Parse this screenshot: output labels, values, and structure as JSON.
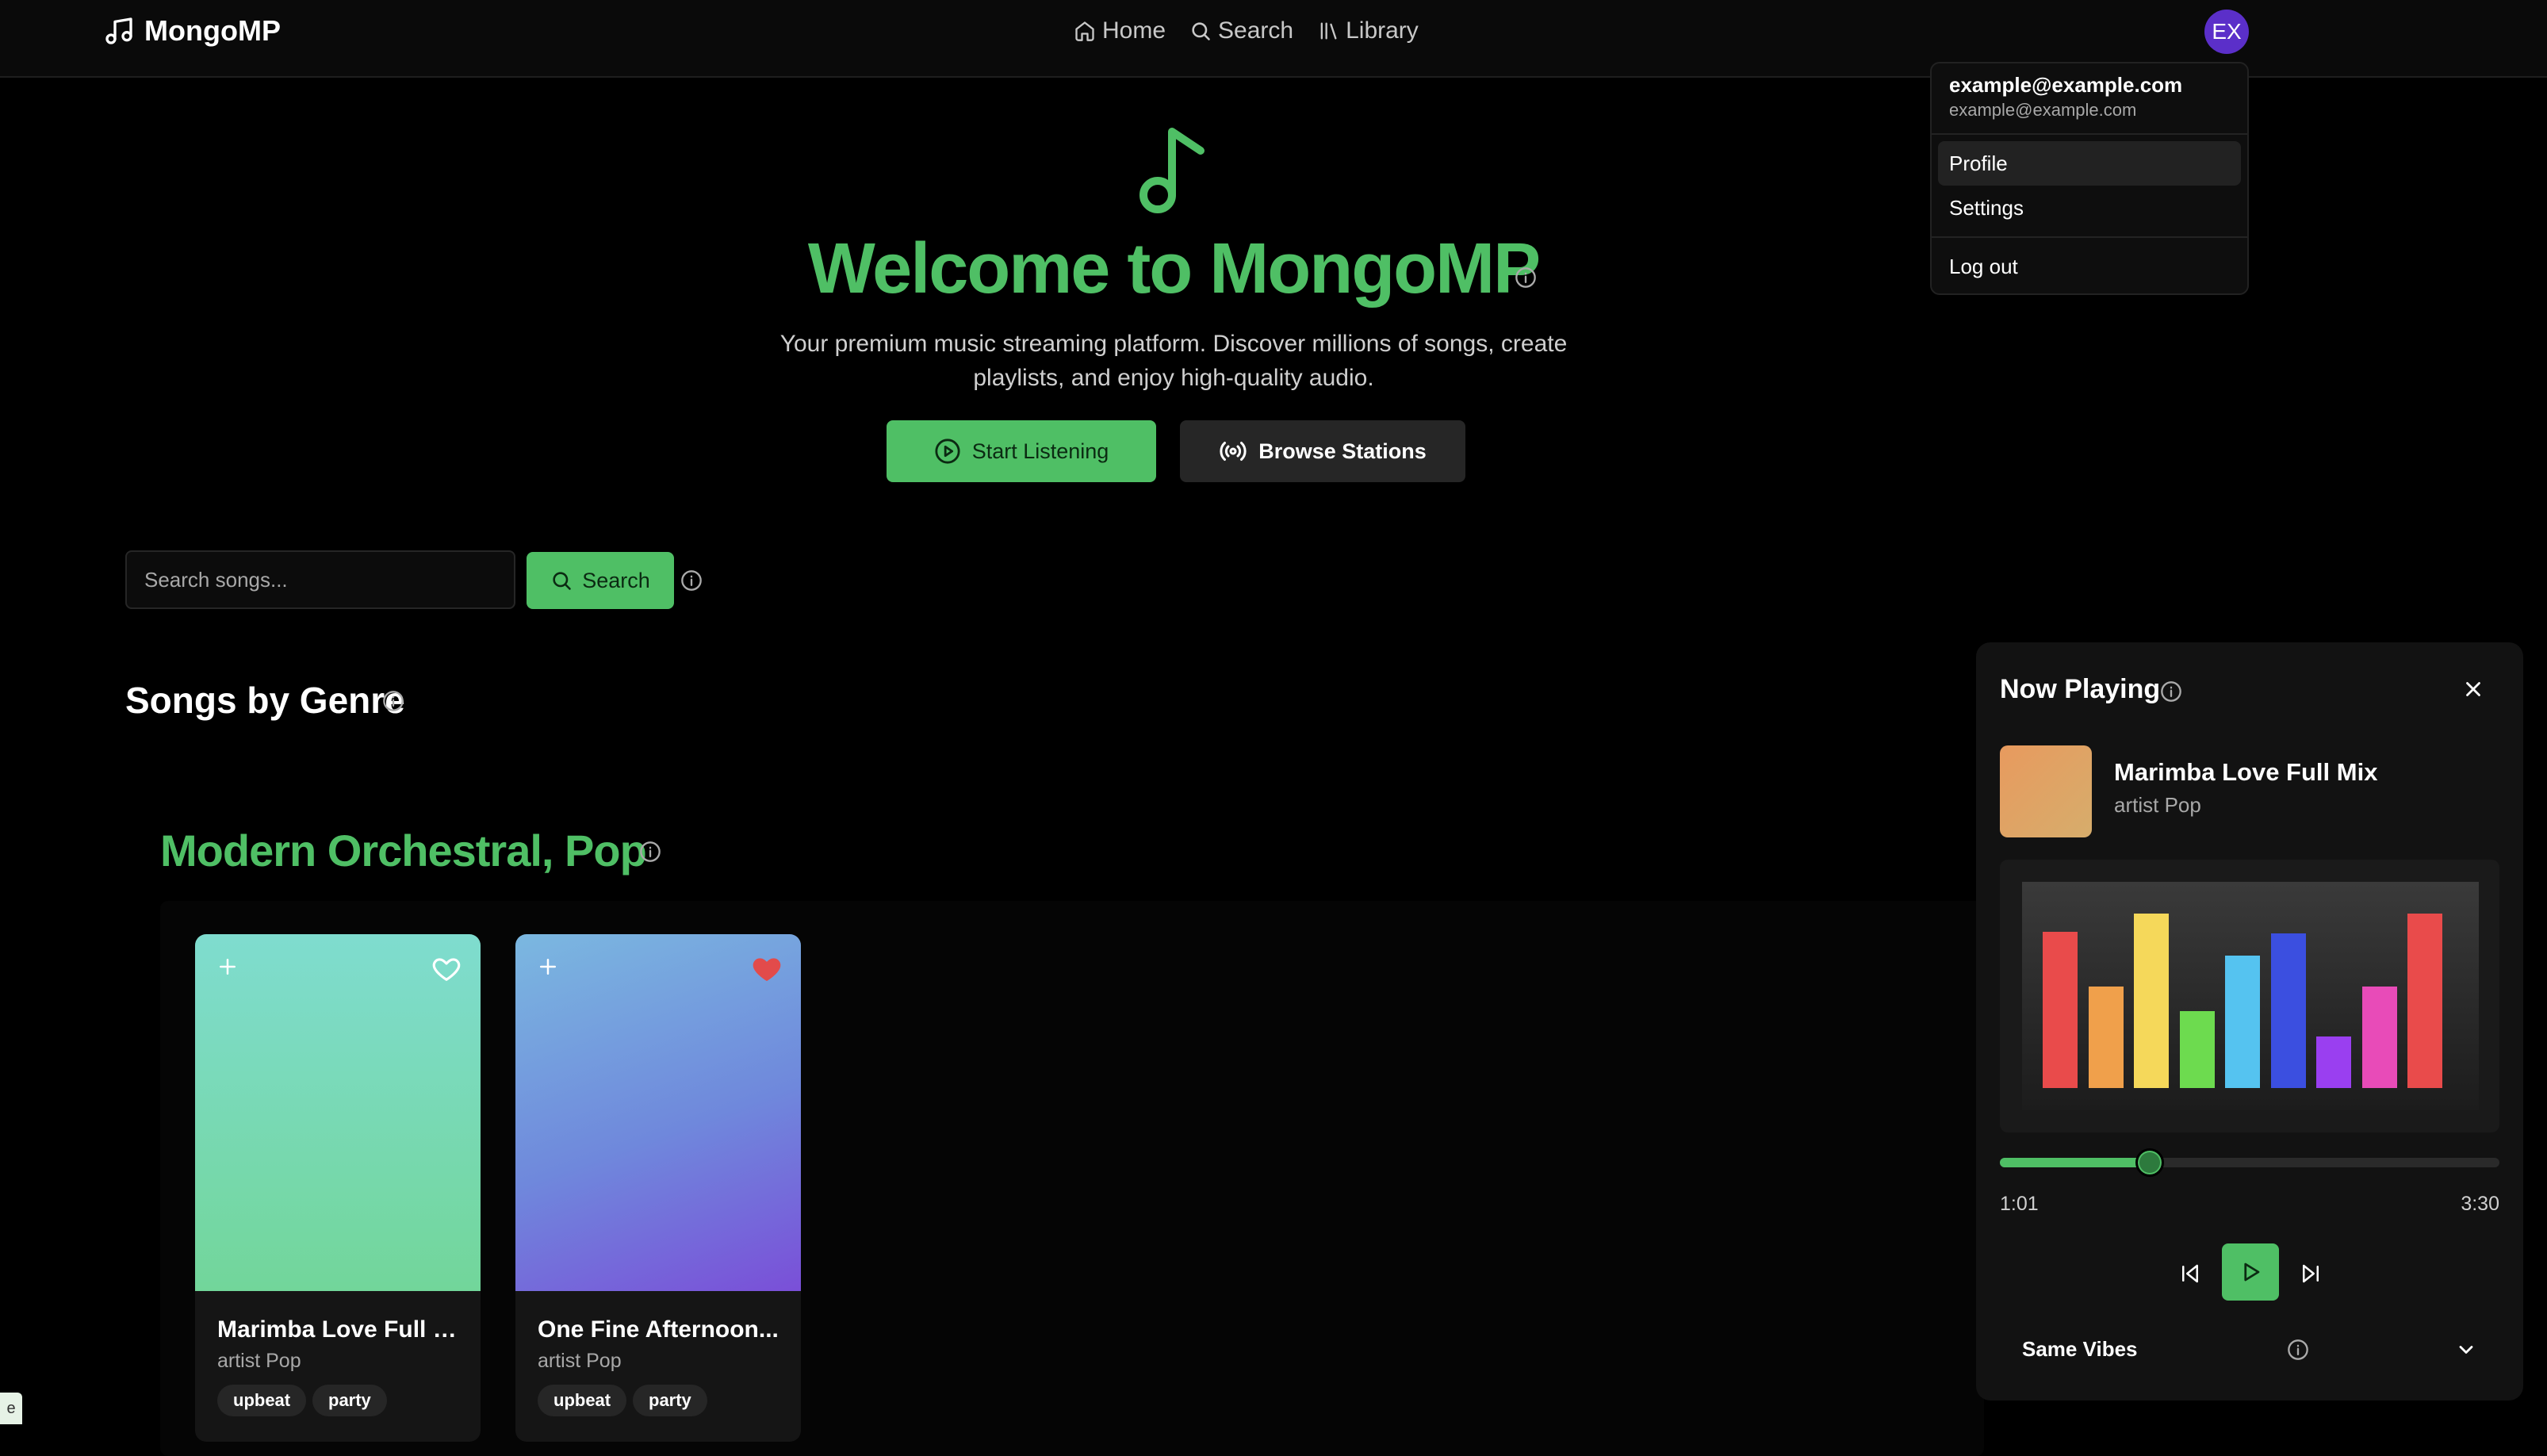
{
  "brand": {
    "name": "MongoMP",
    "icon": "music-note-icon"
  },
  "nav": {
    "items": [
      {
        "label": "Home",
        "icon": "home-icon"
      },
      {
        "label": "Search",
        "icon": "search-icon"
      },
      {
        "label": "Library",
        "icon": "library-icon"
      }
    ]
  },
  "user": {
    "initials": "EX",
    "menu": {
      "email": "example@example.com",
      "email_sub": "example@example.com",
      "items": [
        "Profile",
        "Settings",
        "Log out"
      ]
    }
  },
  "hero": {
    "title": "Welcome to MongoMP",
    "subtitle": "Your premium music streaming platform. Discover millions of songs, create playlists, and enjoy high-quality audio.",
    "start_label": "Start Listening",
    "browse_label": "Browse Stations"
  },
  "search": {
    "placeholder": "Search songs...",
    "button_label": "Search"
  },
  "section": {
    "title": "Songs by Genre",
    "genre_title": "Modern Orchestral, Pop"
  },
  "cards": [
    {
      "title": "Marimba Love Full Mix",
      "artist": "artist Pop",
      "tags": [
        "upbeat",
        "party"
      ],
      "liked": false
    },
    {
      "title": "One Fine Afternoon...",
      "artist": "artist Pop",
      "tags": [
        "upbeat",
        "party"
      ],
      "liked": true
    }
  ],
  "now_playing": {
    "title": "Now Playing",
    "song": "Marimba Love Full Mix",
    "artist": "artist Pop",
    "current_time": "1:01",
    "total_time": "3:30",
    "progress": 0.3,
    "section_label": "Same Vibes",
    "visualizer_levels": [
      0.85,
      0.55,
      0.95,
      0.42,
      0.72,
      0.84,
      0.28,
      0.55,
      0.95
    ],
    "visualizer_colors": [
      "#e94b4b",
      "#f0a04b",
      "#f5d85a",
      "#6ddb4f",
      "#55c3f0",
      "#3b4fe0",
      "#9a3ff0",
      "#e84bb8",
      "#e94b4b"
    ]
  },
  "colors": {
    "accent": "#4fbf65",
    "background": "#000000",
    "panel": "#121212"
  },
  "corner_tag": "e"
}
